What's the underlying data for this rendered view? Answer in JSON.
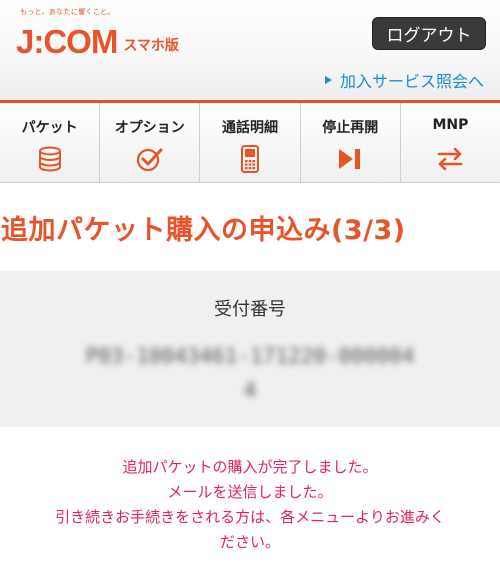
{
  "header": {
    "tagline": "もっと、あなたに響くこと。",
    "logo_text": "J:COM",
    "logo_sub": "スマホ版",
    "logout_label": "ログアウト",
    "service_link": "加入サービス照会へ"
  },
  "nav": {
    "items": [
      {
        "label": "パケット",
        "icon": "database-icon"
      },
      {
        "label": "オプション",
        "icon": "check-circle-icon"
      },
      {
        "label": "通話明細",
        "icon": "mobile-phone-icon"
      },
      {
        "label": "停止再開",
        "icon": "play-pause-icon"
      },
      {
        "label": "MNP",
        "icon": "swap-arrows-icon"
      }
    ]
  },
  "page": {
    "title": "追加パケット購入の申込み(3/3)",
    "receipt_label": "受付番号",
    "receipt_number": "P03-10043461-171220-0000044"
  },
  "messages": [
    "追加パケットの購入が完了しました。",
    "メールを送信しました。",
    "引き続きお手続きをされる方は、各メニューよりお進みく",
    "ださい。"
  ],
  "colors": {
    "brand": "#e8542a",
    "link": "#1e8cc8",
    "message": "#e4235a",
    "logout_bg": "#3a3a3a"
  }
}
